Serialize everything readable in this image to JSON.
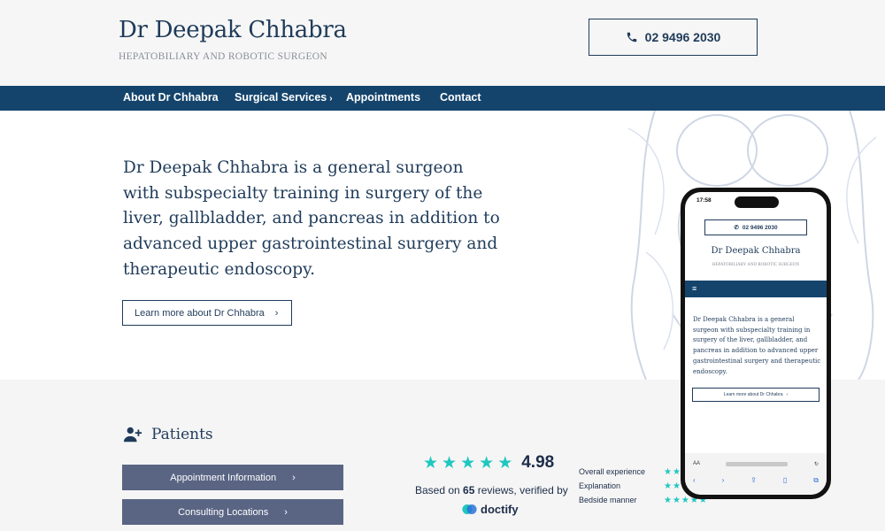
{
  "header": {
    "name": "Dr Deepak Chhabra",
    "subtitle": "HEPATOBILIARY AND ROBOTIC SURGEON",
    "phone": "02 9496 2030"
  },
  "nav": {
    "items": [
      {
        "label": "About Dr Chhabra"
      },
      {
        "label": "Surgical Services"
      },
      {
        "label": "Appointments"
      },
      {
        "label": "Contact"
      }
    ]
  },
  "hero": {
    "text": "Dr Deepak Chhabra is a general surgeon with subspecialty training in surgery of the liver, gallbladder, and pancreas in addition to advanced upper gastrointestinal surgery and therapeutic endoscopy.",
    "button_label": "Learn more about Dr Chhabra"
  },
  "patients": {
    "title": "Patients",
    "buttons": [
      {
        "label": "Appointment Information"
      },
      {
        "label": "Consulting Locations"
      }
    ]
  },
  "reviews": {
    "score": "4.98",
    "based_on_prefix": "Based on ",
    "count": "65",
    "based_on_suffix": " reviews, verified by",
    "provider": "doctify",
    "star_color": "#1fc7c0",
    "criteria": [
      {
        "label": "Overall experience"
      },
      {
        "label": "Explanation"
      },
      {
        "label": "Bedside manner"
      }
    ]
  },
  "phone_mockup": {
    "time": "17:58",
    "phone": "02 9496 2030",
    "name": "Dr Deepak Chhabra",
    "subtitle": "HEPATOBILIARY AND ROBOTIC SURGEON",
    "text": "Dr Deepak Chhabra is a general surgeon with subspecialty training in surgery of the liver, gallbladder, and pancreas in addition to advanced upper gastrointestinal surgery and therapeutic endoscopy.",
    "button_label": "Learn more about Dr Chhabra",
    "text_size_label": "AA"
  },
  "colors": {
    "navy": "#14446c",
    "heading": "#1f3b5a",
    "button_slate": "#5a6584",
    "accent_teal": "#1fc7c0"
  }
}
